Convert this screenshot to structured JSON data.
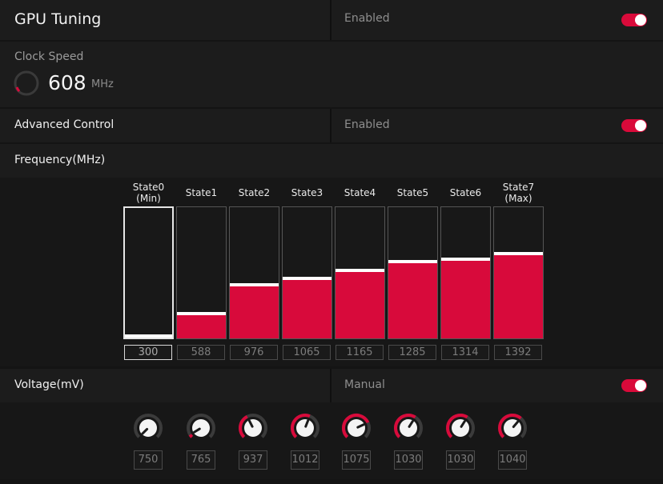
{
  "gpu_tuning": {
    "title": "GPU Tuning",
    "status": "Enabled"
  },
  "clock_speed": {
    "label": "Clock Speed",
    "value": "608",
    "unit": "MHz"
  },
  "advanced_control": {
    "label": "Advanced Control",
    "status": "Enabled"
  },
  "frequency": {
    "label": "Frequency(MHz)",
    "states": [
      {
        "name": "State0",
        "sub": "(Min)",
        "value": "300",
        "fill": 0.0
      },
      {
        "name": "State1",
        "sub": "",
        "value": "588",
        "fill": 0.18
      },
      {
        "name": "State2",
        "sub": "",
        "value": "976",
        "fill": 0.4
      },
      {
        "name": "State3",
        "sub": "",
        "value": "1065",
        "fill": 0.45
      },
      {
        "name": "State4",
        "sub": "",
        "value": "1165",
        "fill": 0.51
      },
      {
        "name": "State5",
        "sub": "",
        "value": "1285",
        "fill": 0.58
      },
      {
        "name": "State6",
        "sub": "",
        "value": "1314",
        "fill": 0.6
      },
      {
        "name": "State7",
        "sub": "(Max)",
        "value": "1392",
        "fill": 0.64
      }
    ]
  },
  "voltage": {
    "label": "Voltage(mV)",
    "mode": "Manual",
    "knobs": [
      {
        "value": "750",
        "level": 0.0
      },
      {
        "value": "765",
        "level": 0.05
      },
      {
        "value": "937",
        "level": 0.4
      },
      {
        "value": "1012",
        "level": 0.58
      },
      {
        "value": "1075",
        "level": 0.74
      },
      {
        "value": "1030",
        "level": 0.62
      },
      {
        "value": "1030",
        "level": 0.62
      },
      {
        "value": "1040",
        "level": 0.65
      }
    ]
  },
  "colors": {
    "accent": "#d80a3b",
    "panel": "#1c1c1c",
    "background": "#141414"
  }
}
